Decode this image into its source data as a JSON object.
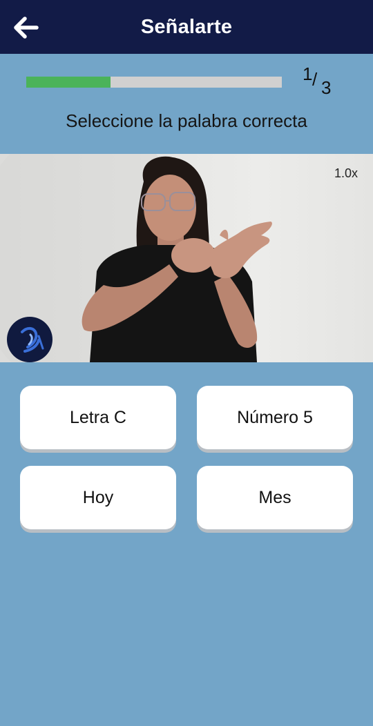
{
  "app_bar": {
    "title": "Señalarte",
    "back_icon": "arrow-left-icon"
  },
  "progress": {
    "current": "1",
    "total": "3",
    "fraction_complete": 0.33,
    "fill_color": "#4bb35a",
    "track_color": "#d0d0d0"
  },
  "question": {
    "instruction": "Seleccione la palabra correcta"
  },
  "video": {
    "speed_label": "1.0x",
    "logo_icon": "hand-logo-icon"
  },
  "options": [
    {
      "label": "Letra C"
    },
    {
      "label": "Número 5"
    },
    {
      "label": "Hoy"
    },
    {
      "label": "Mes"
    }
  ],
  "colors": {
    "app_bar": "#121b47",
    "background": "#73a5c8",
    "option_background": "#ffffff"
  }
}
